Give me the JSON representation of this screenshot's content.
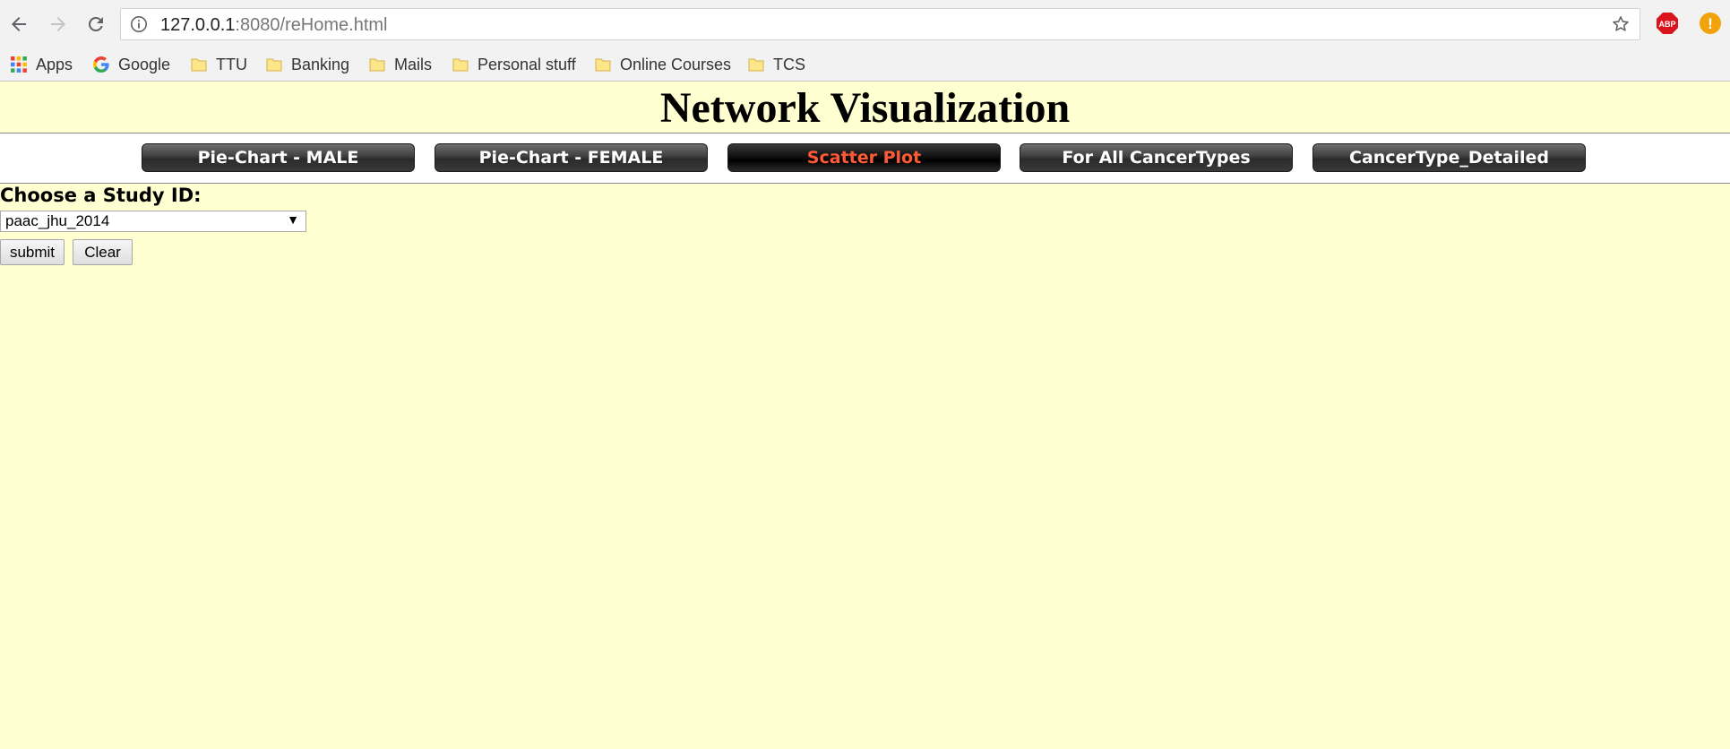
{
  "browser": {
    "url_host": "127.0.0.1",
    "url_rest": ":8080/reHome.html",
    "extension_abp_label": "ABP",
    "extension_alert_label": "!"
  },
  "bookmarks": [
    {
      "label": "Apps",
      "icon": "apps-grid-icon"
    },
    {
      "label": "Google",
      "icon": "google-icon"
    },
    {
      "label": "TTU",
      "icon": "folder-icon"
    },
    {
      "label": "Banking",
      "icon": "folder-icon"
    },
    {
      "label": "Mails",
      "icon": "folder-icon"
    },
    {
      "label": "Personal stuff",
      "icon": "folder-icon"
    },
    {
      "label": "Online Courses",
      "icon": "folder-icon"
    },
    {
      "label": "TCS",
      "icon": "folder-icon"
    }
  ],
  "page": {
    "title": "Network Visualization",
    "nav": [
      {
        "label": "Pie-Chart - MALE",
        "active": false
      },
      {
        "label": "Pie-Chart - FEMALE",
        "active": false
      },
      {
        "label": "Scatter Plot",
        "active": true
      },
      {
        "label": "For All CancerTypes",
        "active": false
      },
      {
        "label": "CancerType_Detailed",
        "active": false
      }
    ],
    "form": {
      "label": "Choose a Study ID:",
      "selected": "paac_jhu_2014",
      "submit_label": "submit",
      "clear_label": "Clear"
    }
  },
  "colors": {
    "page_background": "#ffffd2",
    "active_tab_text": "#ff5a36",
    "tab_text": "#ffffff"
  }
}
